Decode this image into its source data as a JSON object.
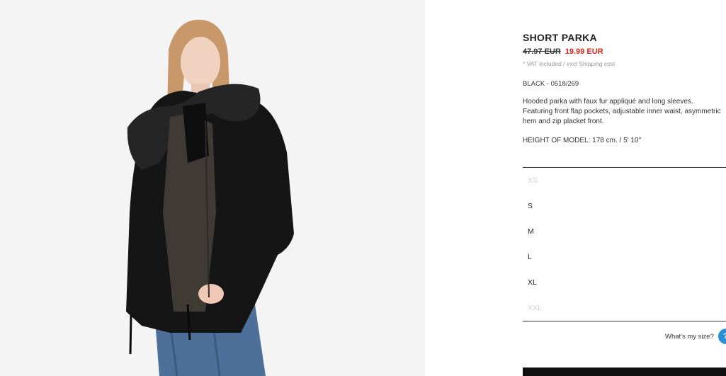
{
  "product": {
    "title": "SHORT PARKA",
    "old_price": "47.97 EUR",
    "new_price": "19.99 EUR",
    "vat_note": "* VAT included / excl Shipping cost",
    "color_ref": "BLACK - 0518/269",
    "description": "Hooded parka with faux fur appliqué and long sleeves. Featuring front flap pockets, adjustable inner waist, asymmetric hem and zip placket front.",
    "model_height": "HEIGHT OF MODEL: 178 cm. / 5' 10\""
  },
  "sizes": [
    {
      "label": "XS",
      "available": false
    },
    {
      "label": "S",
      "available": true
    },
    {
      "label": "M",
      "available": true
    },
    {
      "label": "L",
      "available": true
    },
    {
      "label": "XL",
      "available": true
    },
    {
      "label": "XXL",
      "available": false
    }
  ],
  "size_help": {
    "label": "What's my size?",
    "icon": "help-circle-icon"
  },
  "colors": {
    "sale_price": "#e0261d",
    "help_icon_bg": "#2c8fd6",
    "disabled_size": "#cfcfcf"
  }
}
